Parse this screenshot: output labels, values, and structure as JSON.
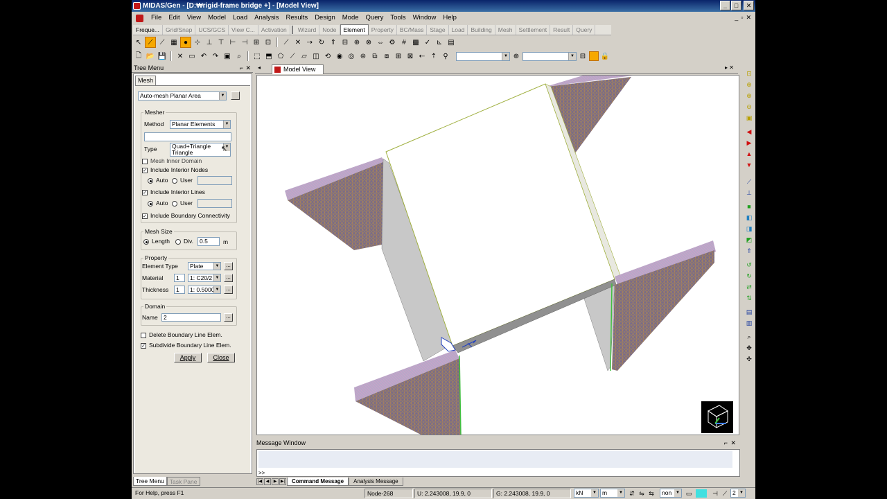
{
  "window": {
    "title": "MIDAS/Gen - [D:₩rigid-frame bridge +] - [Model View]",
    "minimize": "_",
    "maximize": "□",
    "close": "✕"
  },
  "menubar": {
    "items": [
      "File",
      "Edit",
      "View",
      "Model",
      "Load",
      "Analysis",
      "Results",
      "Design",
      "Mode",
      "Query",
      "Tools",
      "Window",
      "Help"
    ],
    "mdi_minimize": "_",
    "mdi_restore": "▫",
    "mdi_close": "✕"
  },
  "tabbar": {
    "left": [
      "Freque...",
      "Grid/Snap",
      "UCS/GCS",
      "View C...",
      "Activation"
    ],
    "right": [
      "Wizard",
      "Node",
      "Element",
      "Property",
      "BC/Mass",
      "Stage",
      "Load",
      "Building",
      "Mesh",
      "Settlement",
      "Result",
      "Query"
    ],
    "active": "Element"
  },
  "tree_menu": {
    "title": "Tree Menu",
    "pin": "⌐",
    "close": "✕",
    "tab": "Mesh",
    "function_select": "Auto-mesh Planar Area",
    "mesher": {
      "group": "Mesher",
      "method_label": "Method",
      "method_value": "Planar Elements",
      "type_label": "Type",
      "type_value": "Quad+Triangle",
      "type_option_2": "Triangle",
      "mesh_inner_domain": "Mesh Inner Domain",
      "include_interior_nodes": "Include Interior Nodes",
      "auto": "Auto",
      "user": "User",
      "include_interior_lines": "Include Interior Lines",
      "include_boundary_connectivity": "Include Boundary Connectivity"
    },
    "mesh_size": {
      "group": "Mesh Size",
      "length": "Length",
      "div": "Div.",
      "value": "0.5",
      "unit": "m"
    },
    "property": {
      "group": "Property",
      "element_type_label": "Element Type",
      "element_type_value": "Plate",
      "material_label": "Material",
      "material_num": "1",
      "material_value": "1: C20/2",
      "thickness_label": "Thickness",
      "thickness_num": "1",
      "thickness_value": "1: 0.5000"
    },
    "domain": {
      "group": "Domain",
      "name_label": "Name",
      "name_value": "2"
    },
    "delete_boundary": "Delete Boundary Line Elem.",
    "subdivide_boundary": "Subdivide Boundary Line Elem.",
    "apply": "Apply",
    "close_btn": "Close",
    "dots": "...",
    "bottom_tabs": [
      "Tree Menu",
      "Task Pane"
    ]
  },
  "model_view": {
    "tab": "Model View",
    "nav_left": "◂",
    "nav_right": "▸ ✕"
  },
  "message_window": {
    "title": "Message Window",
    "pin": "⌐",
    "close": "✕",
    "prompt": ">>",
    "tabs": [
      "Command Message",
      "Analysis Message"
    ]
  },
  "statusbar": {
    "help": "For Help, press F1",
    "node": "Node-268",
    "u_coord": "U: 2.243008, 19.9, 0",
    "g_coord": "G: 2.243008, 19.9, 0",
    "force_unit": "kN",
    "length_unit": "m",
    "snap": "non",
    "page": "2"
  },
  "colors": {
    "accent": "#f6a800",
    "title_start": "#0a246a",
    "title_end": "#3a6ea5",
    "mesh_purple": "#7a6a8a",
    "mesh_orange": "#c88a40"
  }
}
